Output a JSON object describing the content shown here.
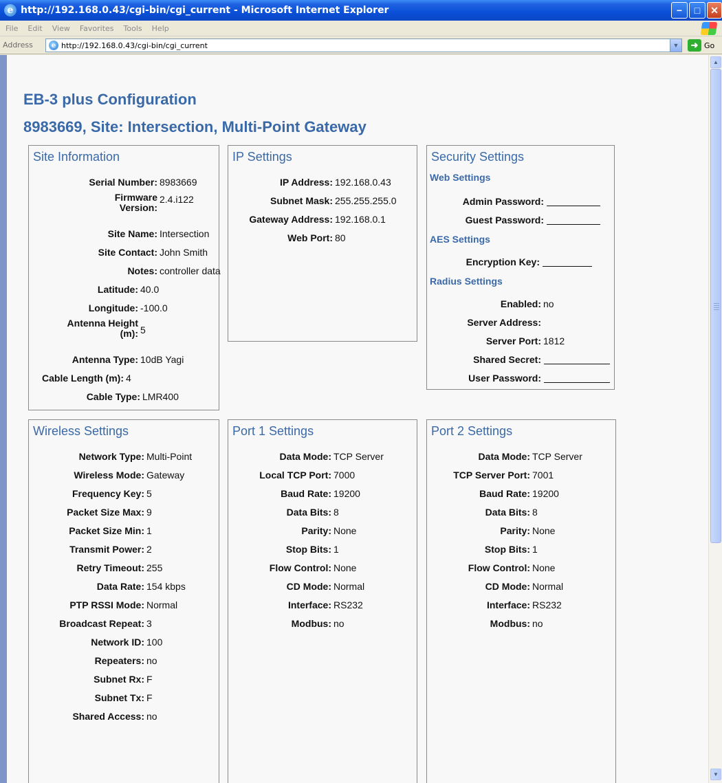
{
  "window": {
    "title": "http://192.168.0.43/cgi-bin/cgi_current - Microsoft Internet Explorer"
  },
  "menu": [
    "File",
    "Edit",
    "View",
    "Favorites",
    "Tools",
    "Help"
  ],
  "address": {
    "label": "Address",
    "url": "http://192.168.0.43/cgi-bin/cgi_current",
    "go_label": "Go"
  },
  "page": {
    "title": "EB-3 plus Configuration",
    "subtitle": "8983669, Site: Intersection, Multi-Point Gateway"
  },
  "site": {
    "title": "Site Information",
    "serial_label": "Serial Number:",
    "serial": "8983669",
    "firmware_label1": "Firmware",
    "firmware_label2": "Version:",
    "firmware": "2.4.i122",
    "sitename_label": "Site Name:",
    "sitename": "Intersection",
    "contact_label": "Site Contact:",
    "contact": "John Smith",
    "notes_label": "Notes:",
    "notes": "controller data",
    "lat_label": "Latitude:",
    "lat": "40.0",
    "lon_label": "Longitude:",
    "lon": "-100.0",
    "antheight_label1": "Antenna Height",
    "antheight_label2": "(m):",
    "antheight": "5",
    "anttype_label": "Antenna Type:",
    "anttype": "10dB Yagi",
    "cablelen_label": "Cable Length (m):",
    "cablelen": "4",
    "cabletype_label": "Cable Type:",
    "cabletype": "LMR400"
  },
  "ip": {
    "title": "IP Settings",
    "addr_label": "IP Address:",
    "addr": "192.168.0.43",
    "mask_label": "Subnet Mask:",
    "mask": "255.255.255.0",
    "gw_label": "Gateway Address:",
    "gw": "192.168.0.1",
    "port_label": "Web Port:",
    "port": "80"
  },
  "security": {
    "title": "Security Settings",
    "web_heading": "Web Settings",
    "admin_label": "Admin Password:",
    "guest_label": "Guest Password:",
    "aes_heading": "AES Settings",
    "enc_label": "Encryption Key:",
    "radius_heading": "Radius Settings",
    "enabled_label": "Enabled:",
    "enabled": "no",
    "server_label": "Server Address:",
    "serverport_label": "Server Port:",
    "serverport": "1812",
    "secret_label": "Shared Secret:",
    "userpw_label": "User Password:"
  },
  "wireless": {
    "title": "Wireless Settings",
    "nettype_label": "Network Type:",
    "nettype": "Multi-Point",
    "mode_label": "Wireless Mode:",
    "mode": "Gateway",
    "freq_label": "Frequency Key:",
    "freq": "5",
    "pktmax_label": "Packet Size Max:",
    "pktmax": "9",
    "pktmin_label": "Packet Size Min:",
    "pktmin": "1",
    "power_label": "Transmit Power:",
    "power": "2",
    "retry_label": "Retry Timeout:",
    "retry": "255",
    "rate_label": "Data Rate:",
    "rate": "154 kbps",
    "rssi_label": "PTP RSSI Mode:",
    "rssi": "Normal",
    "bcast_label": "Broadcast Repeat:",
    "bcast": "3",
    "netid_label": "Network ID:",
    "netid": "100",
    "repeaters_label": "Repeaters:",
    "repeaters": "no",
    "subrx_label": "Subnet Rx:",
    "subrx": "F",
    "subtx_label": "Subnet Tx:",
    "subtx": "F",
    "shared_label": "Shared Access:",
    "shared": "no"
  },
  "port1": {
    "title": "Port 1 Settings",
    "datamode_label": "Data Mode:",
    "datamode": "TCP Server",
    "tcpport_label": "Local TCP Port:",
    "tcpport": "7000",
    "baud_label": "Baud Rate:",
    "baud": "19200",
    "databits_label": "Data Bits:",
    "databits": "8",
    "parity_label": "Parity:",
    "parity": "None",
    "stopbits_label": "Stop Bits:",
    "stopbits": "1",
    "flow_label": "Flow Control:",
    "flow": "None",
    "cd_label": "CD Mode:",
    "cd": "Normal",
    "iface_label": "Interface:",
    "iface": "RS232",
    "modbus_label": "Modbus:",
    "modbus": "no"
  },
  "port2": {
    "title": "Port 2 Settings",
    "datamode_label": "Data Mode:",
    "datamode": "TCP Server",
    "tcpport_label": "TCP Server Port:",
    "tcpport": "7001",
    "baud_label": "Baud Rate:",
    "baud": "19200",
    "databits_label": "Data Bits:",
    "databits": "8",
    "parity_label": "Parity:",
    "parity": "None",
    "stopbits_label": "Stop Bits:",
    "stopbits": "1",
    "flow_label": "Flow Control:",
    "flow": "None",
    "cd_label": "CD Mode:",
    "cd": "Normal",
    "iface_label": "Interface:",
    "iface": "RS232",
    "modbus_label": "Modbus:",
    "modbus": "no"
  }
}
